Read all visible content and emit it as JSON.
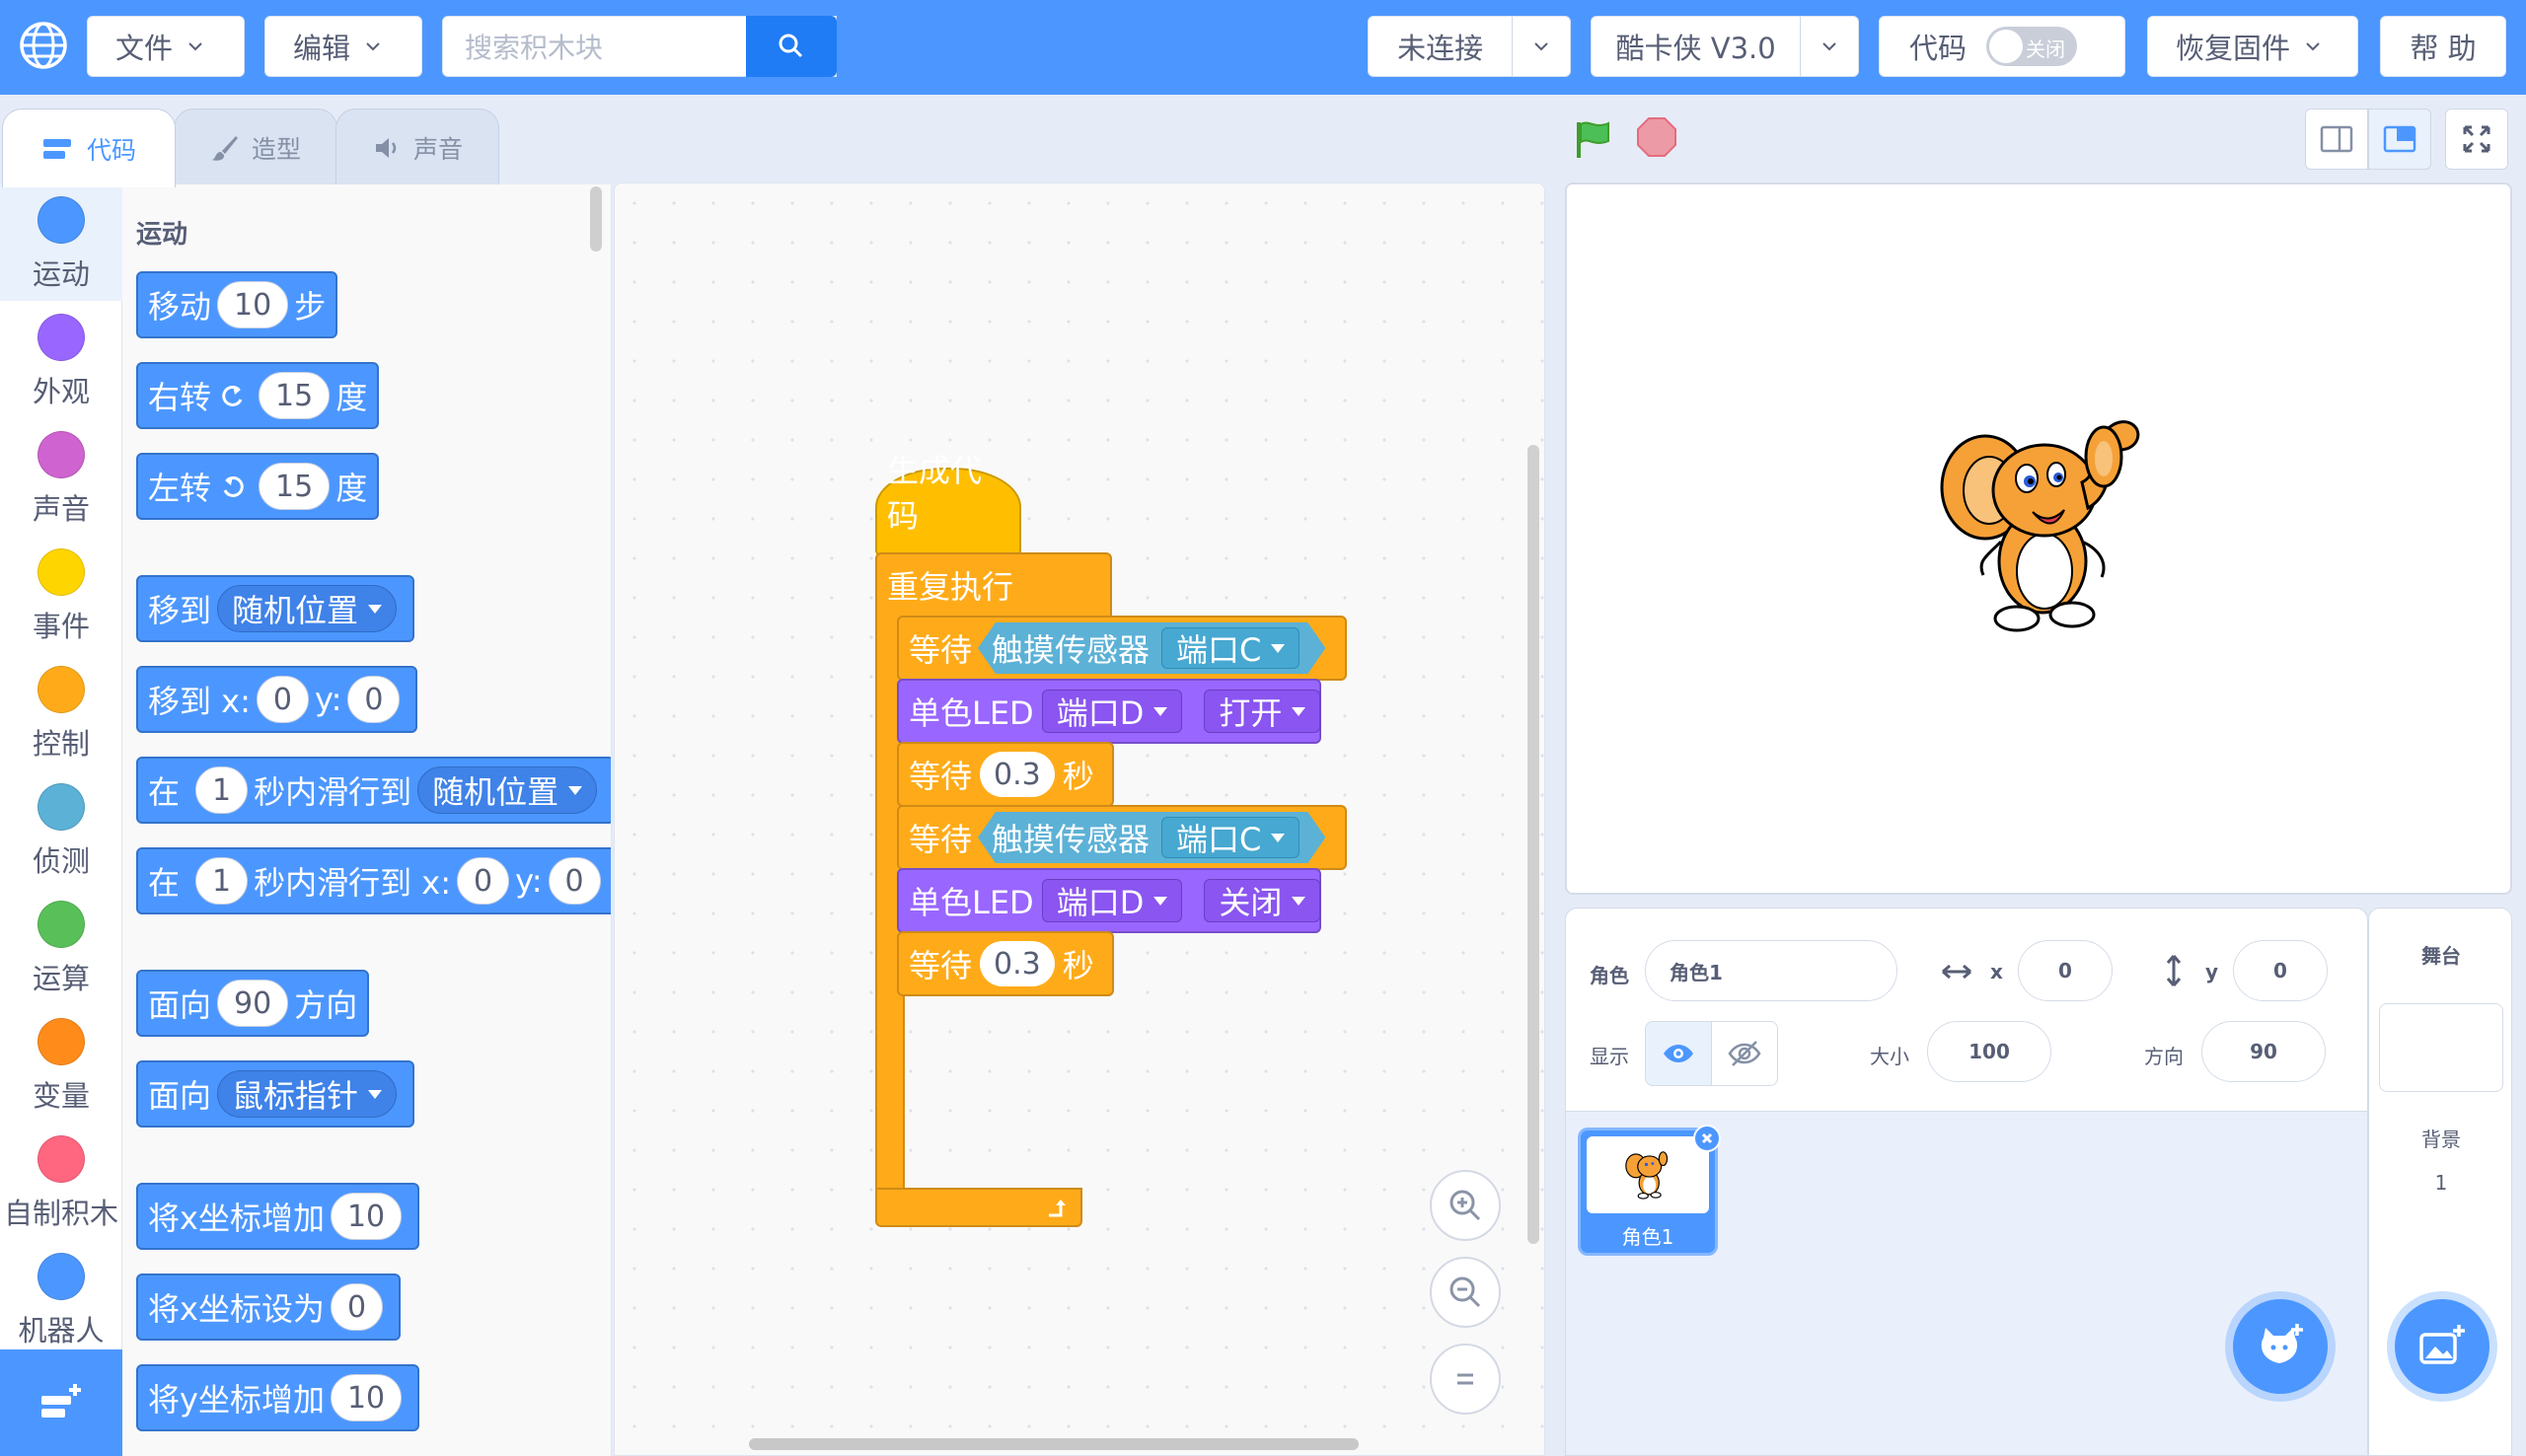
{
  "topbar": {
    "file_menu": "文件",
    "edit_menu": "编辑",
    "search_placeholder": "搜索积木块",
    "connection": "未连接",
    "device": "酷卡侠 V3.0",
    "code_label": "代码",
    "code_toggle": "关闭",
    "restore_firmware": "恢复固件",
    "help": "帮 助",
    "accent": "#4c97ff"
  },
  "tabs": {
    "code": "代码",
    "costume": "造型",
    "sound": "声音"
  },
  "categories": [
    {
      "label": "运动",
      "color": "#4c97ff"
    },
    {
      "label": "外观",
      "color": "#9966ff"
    },
    {
      "label": "声音",
      "color": "#cf63cf"
    },
    {
      "label": "事件",
      "color": "#ffd500"
    },
    {
      "label": "控制",
      "color": "#ffab19"
    },
    {
      "label": "侦测",
      "color": "#5cb1d6"
    },
    {
      "label": "运算",
      "color": "#59c059"
    },
    {
      "label": "变量",
      "color": "#ff8c1a"
    },
    {
      "label": "自制积木",
      "color": "#ff6680"
    },
    {
      "label": "机器人",
      "color": "#4c97ff"
    }
  ],
  "palette": {
    "heading": "运动",
    "move": {
      "a": "移动",
      "v": "10",
      "b": "步"
    },
    "turn_right": {
      "a": "右转",
      "v": "15",
      "b": "度"
    },
    "turn_left": {
      "a": "左转",
      "v": "15",
      "b": "度"
    },
    "goto": {
      "a": "移到",
      "opt": "随机位置"
    },
    "goto_xy": {
      "a": "移到 x:",
      "x": "0",
      "yl": "y:",
      "y": "0"
    },
    "glide": {
      "a": "在",
      "v": "1",
      "b": "秒内滑行到",
      "opt": "随机位置"
    },
    "glide_xy": {
      "a": "在",
      "v": "1",
      "b": "秒内滑行到 x:",
      "x": "0",
      "yl": "y:",
      "y": "0"
    },
    "point_dir": {
      "a": "面向",
      "v": "90",
      "b": "方向"
    },
    "point_towards": {
      "a": "面向",
      "opt": "鼠标指针"
    },
    "change_x": {
      "a": "将x坐标增加",
      "v": "10"
    },
    "set_x": {
      "a": "将x坐标设为",
      "v": "0"
    },
    "change_y": {
      "a": "将y坐标增加",
      "v": "10"
    }
  },
  "script": {
    "hat": "生成代码",
    "forever": "重复执行",
    "wait1": {
      "a": "等待",
      "sensor": "触摸传感器",
      "port": "端口C"
    },
    "led1": {
      "a": "单色LED",
      "port": "端口D",
      "state": "打开"
    },
    "wait2": {
      "a": "等待",
      "v": "0.3",
      "b": "秒"
    },
    "wait3": {
      "a": "等待",
      "sensor": "触摸传感器",
      "port": "端口C"
    },
    "led2": {
      "a": "单色LED",
      "port": "端口D",
      "state": "关闭"
    },
    "wait4": {
      "a": "等待",
      "v": "0.3",
      "b": "秒"
    }
  },
  "sprite": {
    "label": "角色",
    "name": "角色1",
    "x_label": "x",
    "x": "0",
    "y_label": "y",
    "y": "0",
    "show_label": "显示",
    "size_label": "大小",
    "size": "100",
    "dir_label": "方向",
    "dir": "90",
    "thumb_name": "角色1"
  },
  "stage_panel": {
    "title": "舞台",
    "backdrop_label": "背景",
    "backdrop_count": "1"
  }
}
